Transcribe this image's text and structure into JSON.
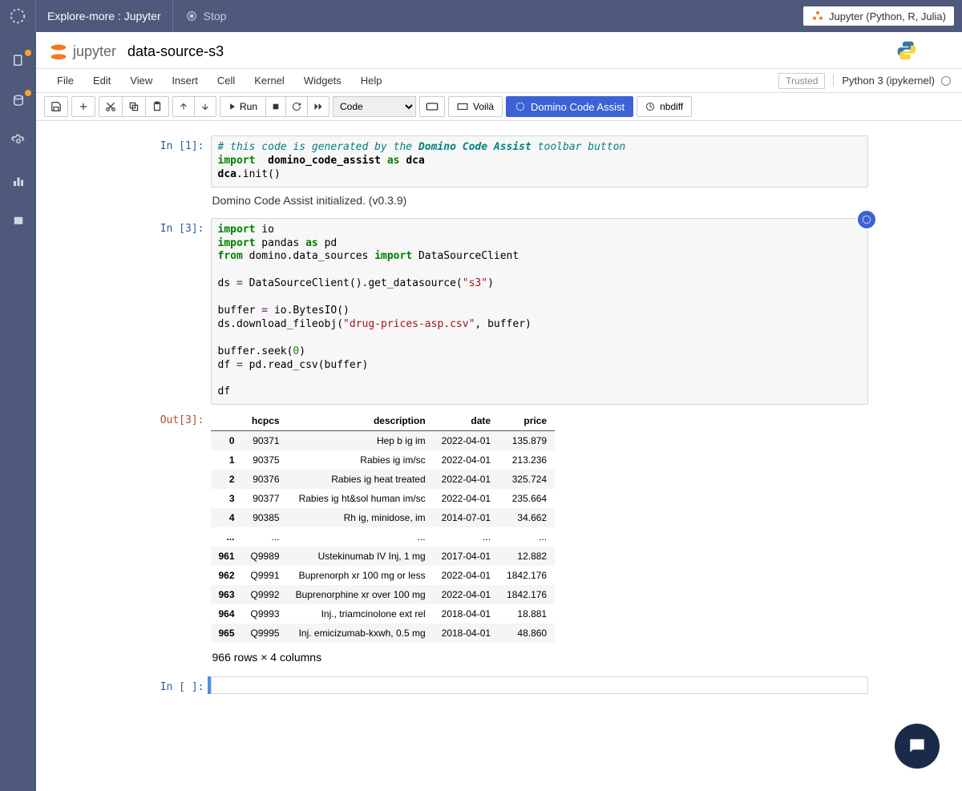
{
  "topbar": {
    "title": "Explore-more : Jupyter",
    "stop": "Stop",
    "pill": "Jupyter (Python, R, Julia)"
  },
  "header": {
    "nb_name": "data-source-s3",
    "logo_text": "jupyter"
  },
  "menu": {
    "file": "File",
    "edit": "Edit",
    "view": "View",
    "insert": "Insert",
    "cell": "Cell",
    "kernel": "Kernel",
    "widgets": "Widgets",
    "help": "Help",
    "trusted": "Trusted",
    "kernel_name": "Python 3 (ipykernel)"
  },
  "toolbar": {
    "run": "Run",
    "voila": "Voilà",
    "dca": "Domino Code Assist",
    "nbdiff": "nbdiff",
    "celltype": "Code"
  },
  "cells": {
    "c1_prompt": "In [1]:",
    "c1_out_text": "Domino Code Assist initialized.  (v0.3.9)",
    "c1_comment": "# this code is generated by the ",
    "c1_comment_em": "Domino Code Assist",
    "c1_comment_tail": " toolbar button",
    "c1_l2_import": "import",
    "c1_l2_mod": "  domino_code_assist ",
    "c1_l2_as": "as",
    "c1_l2_alias": " dca",
    "c1_l3_obj": "dca",
    "c1_l3_call": ".init()",
    "c2_prompt": "In [3]:",
    "c2_l1_import": "import",
    "c2_l1_mod": " io",
    "c2_l2_import": "import",
    "c2_l2_mod": " pandas ",
    "c2_l2_as": "as",
    "c2_l2_alias": " pd",
    "c2_l3_from": "from",
    "c2_l3_mod": " domino.data_sources ",
    "c2_l3_import": "import",
    "c2_l3_target": " DataSourceClient",
    "c2_l5a": "ds ",
    "c2_l5eq": "=",
    "c2_l5b": " DataSourceClient().get_datasource(",
    "c2_l5str": "\"s3\"",
    "c2_l5c": ")",
    "c2_l7a": "buffer ",
    "c2_l7eq": "=",
    "c2_l7b": " io.BytesIO()",
    "c2_l8a": "ds.download_fileobj(",
    "c2_l8str": "\"drug-prices-asp.csv\"",
    "c2_l8b": ", buffer)",
    "c2_l10a": "buffer.seek(",
    "c2_l10num": "0",
    "c2_l10b": ")",
    "c2_l11a": "df ",
    "c2_l11eq": "=",
    "c2_l11b": " pd.read_csv(buffer)",
    "c2_l13": "df",
    "out_prompt": "Out[3]:",
    "df_meta": "966 rows × 4 columns",
    "c3_prompt": "In [ ]:"
  },
  "table": {
    "headers": [
      "",
      "hcpcs",
      "description",
      "date",
      "price"
    ],
    "rows": [
      {
        "idx": "0",
        "hcpcs": "90371",
        "desc": "Hep b ig im",
        "date": "2022-04-01",
        "price": "135.879"
      },
      {
        "idx": "1",
        "hcpcs": "90375",
        "desc": "Rabies ig im/sc",
        "date": "2022-04-01",
        "price": "213.236"
      },
      {
        "idx": "2",
        "hcpcs": "90376",
        "desc": "Rabies ig heat treated",
        "date": "2022-04-01",
        "price": "325.724"
      },
      {
        "idx": "3",
        "hcpcs": "90377",
        "desc": "Rabies ig ht&sol human im/sc",
        "date": "2022-04-01",
        "price": "235.664"
      },
      {
        "idx": "4",
        "hcpcs": "90385",
        "desc": "Rh ig, minidose, im",
        "date": "2014-07-01",
        "price": "34.662"
      },
      {
        "idx": "...",
        "hcpcs": "...",
        "desc": "...",
        "date": "...",
        "price": "..."
      },
      {
        "idx": "961",
        "hcpcs": "Q9989",
        "desc": "Ustekinumab IV Inj, 1 mg",
        "date": "2017-04-01",
        "price": "12.882"
      },
      {
        "idx": "962",
        "hcpcs": "Q9991",
        "desc": "Buprenorph xr 100 mg or less",
        "date": "2022-04-01",
        "price": "1842.176"
      },
      {
        "idx": "963",
        "hcpcs": "Q9992",
        "desc": "Buprenorphine xr over 100 mg",
        "date": "2022-04-01",
        "price": "1842.176"
      },
      {
        "idx": "964",
        "hcpcs": "Q9993",
        "desc": "Inj., triamcinolone ext rel",
        "date": "2018-04-01",
        "price": "18.881"
      },
      {
        "idx": "965",
        "hcpcs": "Q9995",
        "desc": "Inj. emicizumab-kxwh, 0.5 mg",
        "date": "2018-04-01",
        "price": "48.860"
      }
    ]
  }
}
